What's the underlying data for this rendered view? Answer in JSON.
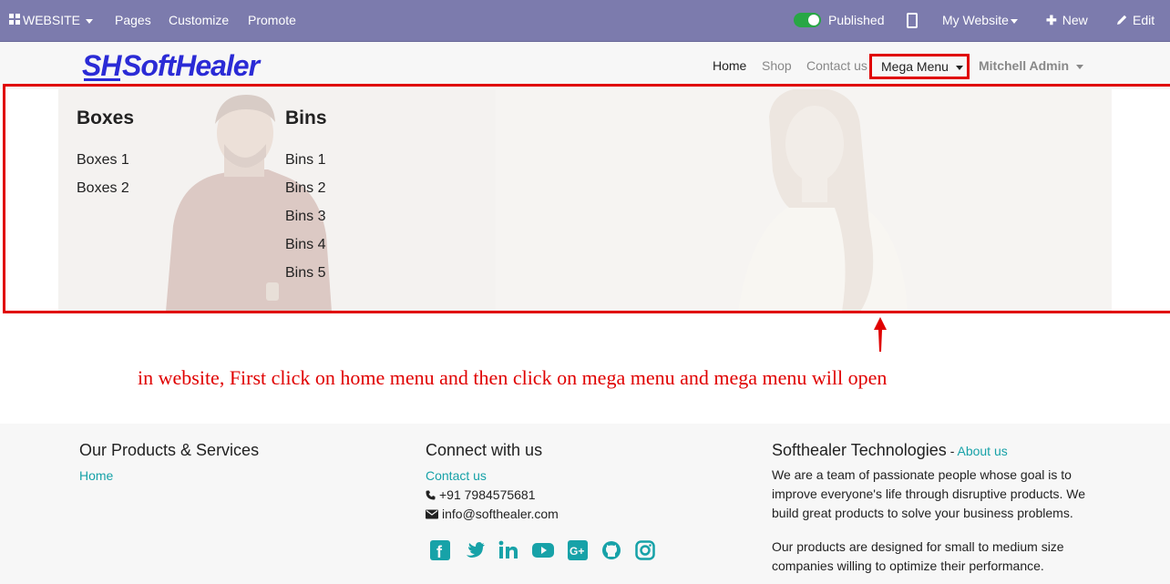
{
  "topbar": {
    "website": "WEBSITE",
    "pages": "Pages",
    "customize": "Customize",
    "promote": "Promote",
    "published": "Published",
    "my_website": "My Website",
    "new": "New",
    "edit": "Edit"
  },
  "header": {
    "logo_text": "SoftHealer",
    "nav": {
      "home": "Home",
      "shop": "Shop",
      "contact": "Contact us",
      "mega_menu": "Mega Menu",
      "user": "Mitchell Admin"
    }
  },
  "mega": {
    "col1": {
      "title": "Boxes",
      "links": [
        "Boxes 1",
        "Boxes 2"
      ]
    },
    "col2": {
      "title": "Bins",
      "links": [
        "Bins 1",
        "Bins 2",
        "Bins 3",
        "Bins 4",
        "Bins 5"
      ]
    }
  },
  "instruction": "in website, First click on home menu and then click on mega menu and mega menu will open",
  "footer": {
    "col1": {
      "title": "Our Products & Services",
      "link": "Home"
    },
    "col2": {
      "title": "Connect with us",
      "contact": "Contact us",
      "phone": "+91 7984575681",
      "email": "info@softhealer.com"
    },
    "col3": {
      "title": "Softhealer Technologies",
      "sep": " - ",
      "about": "About us",
      "p1": "We are a team of passionate people whose goal is to improve everyone's life through disruptive products. We build great products to solve your business problems.",
      "p2": "Our products are designed for small to medium size companies willing to optimize their performance."
    },
    "social_icons": [
      "facebook-icon",
      "twitter-icon",
      "linkedin-icon",
      "youtube-icon",
      "google-plus-icon",
      "github-icon",
      "instagram-icon"
    ]
  },
  "colors": {
    "topbar": "#7c7bad",
    "accent": "#17a2a8",
    "annotation": "#e00000",
    "toggle_on": "#28a745"
  }
}
